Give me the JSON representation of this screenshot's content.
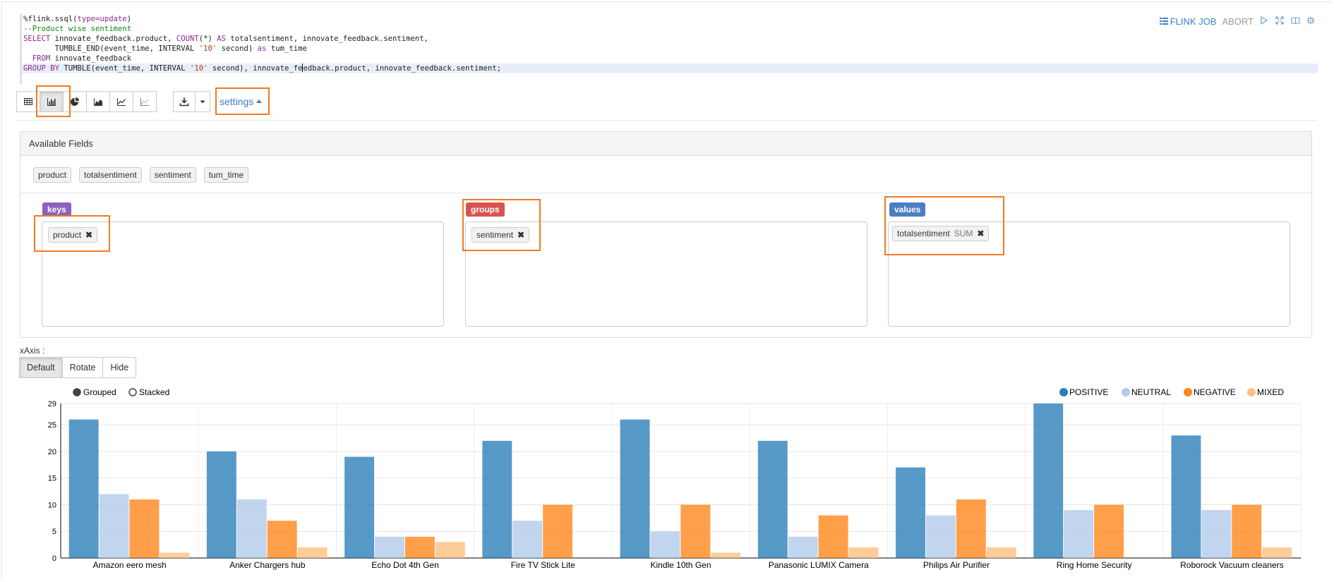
{
  "editor": {
    "lines": [
      [
        {
          "t": "%flink.ssql(",
          "c": ""
        },
        {
          "t": "type=update",
          "c": "kw"
        },
        {
          "t": ")",
          "c": ""
        }
      ],
      [
        {
          "t": "--Product wise sentiment",
          "c": "cm"
        }
      ],
      [
        {
          "t": "SELECT",
          "c": "kw"
        },
        {
          "t": " innovate_feedback.product, ",
          "c": ""
        },
        {
          "t": "COUNT",
          "c": "fn"
        },
        {
          "t": "(*) ",
          "c": ""
        },
        {
          "t": "AS",
          "c": "kw"
        },
        {
          "t": " totalsentiment, innovate_feedback.sentiment,",
          "c": ""
        }
      ],
      [
        {
          "t": "       TUMBLE_END(event_time, INTERVAL ",
          "c": ""
        },
        {
          "t": "'10'",
          "c": "st"
        },
        {
          "t": " second) ",
          "c": ""
        },
        {
          "t": "as",
          "c": "kw"
        },
        {
          "t": " tum_time",
          "c": ""
        }
      ],
      [
        {
          "t": "  FROM",
          "c": "kw"
        },
        {
          "t": " innovate_feedback",
          "c": ""
        }
      ],
      [
        {
          "t": "GROUP BY",
          "c": "kw"
        },
        {
          "t": " TUMBLE(event_time, INTERVAL ",
          "c": ""
        },
        {
          "t": "'10'",
          "c": "st"
        },
        {
          "t": " second), innovate_fe",
          "c": ""
        },
        {
          "t": "|",
          "c": "cursor"
        },
        {
          "t": "edback.product, innovate_feedback.sentiment;",
          "c": ""
        }
      ]
    ]
  },
  "topbar": {
    "flink_job": "FLINK JOB",
    "abort": "ABORT"
  },
  "toolbar": {
    "settings_label": "settings",
    "active_chart": "bar"
  },
  "settings": {
    "available_fields_title": "Available Fields",
    "fields": [
      "product",
      "totalsentiment",
      "sentiment",
      "tum_time"
    ],
    "keys_label": "keys",
    "groups_label": "groups",
    "values_label": "values",
    "keys": [
      {
        "name": "product"
      }
    ],
    "groups": [
      {
        "name": "sentiment"
      }
    ],
    "values": [
      {
        "name": "totalsentiment",
        "agg": "SUM"
      }
    ],
    "colors": {
      "keys": "#8c62c0",
      "groups": "#d9534f",
      "values": "#4b7ec4"
    }
  },
  "xaxis": {
    "label": "xAxis :",
    "options": [
      "Default",
      "Rotate",
      "Hide"
    ],
    "selected": "Default"
  },
  "chart_data": {
    "type": "bar",
    "mode_options": [
      "Grouped",
      "Stacked"
    ],
    "mode_selected": "Grouped",
    "categories": [
      "Amazon eero mesh",
      "Anker Chargers hub",
      "Echo Dot 4th Gen",
      "Fire TV Stick Lite",
      "Kindle 10th Gen",
      "Panasonic LUMIX Camera",
      "Philips Air Purifier",
      "Ring Home Security",
      "Roborock Vacuum cleaners"
    ],
    "series": [
      {
        "name": "POSITIVE",
        "color": "#1f77b4",
        "values": [
          26,
          20,
          19,
          22,
          26,
          22,
          17,
          29,
          23
        ]
      },
      {
        "name": "NEUTRAL",
        "color": "#aec7e8",
        "values": [
          12,
          11,
          4,
          7,
          5,
          4,
          8,
          9,
          9
        ]
      },
      {
        "name": "NEGATIVE",
        "color": "#ff7f0e",
        "values": [
          11,
          7,
          4,
          10,
          10,
          8,
          11,
          10,
          10
        ]
      },
      {
        "name": "MIXED",
        "color": "#ffbb78",
        "values": [
          1,
          2,
          3,
          0,
          1,
          2,
          2,
          0,
          2
        ]
      }
    ],
    "yticks": [
      0,
      5,
      10,
      15,
      20,
      25,
      29
    ],
    "ylim": [
      0,
      29
    ],
    "grid": true,
    "legend_position": "top-right"
  }
}
